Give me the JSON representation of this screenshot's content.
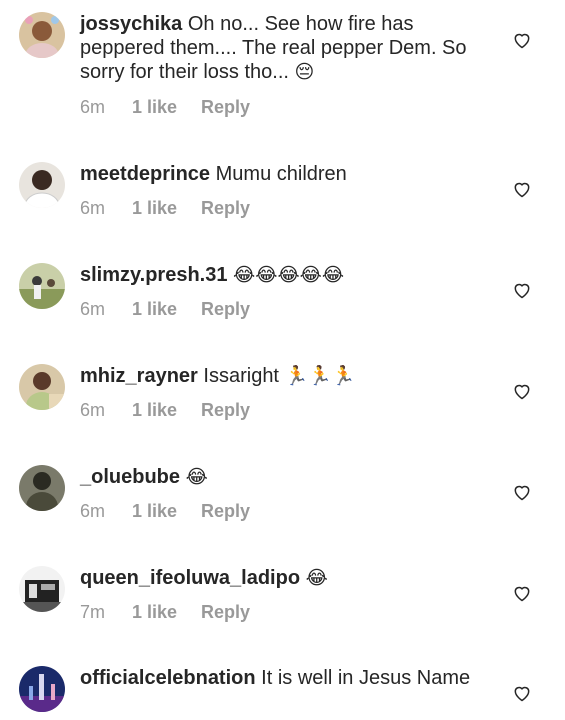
{
  "comments": [
    {
      "username": "jossychika",
      "text": "Oh no... See how fire has peppered them.... The real pepper Dem. So sorry for their loss tho...",
      "emoji": "😔",
      "time": "6m",
      "likes": "1 like",
      "reply": "Reply",
      "avatar_color": "#c8a878"
    },
    {
      "username": "meetdeprince",
      "text": "Mumu children",
      "emoji": "",
      "time": "6m",
      "likes": "1 like",
      "reply": "Reply",
      "avatar_color": "#6a5040"
    },
    {
      "username": "slimzy.presh.31",
      "text": "",
      "emoji": "😂😂😂😂😂",
      "time": "6m",
      "likes": "1 like",
      "reply": "Reply",
      "avatar_color": "#9aa86a"
    },
    {
      "username": "mhiz_rayner",
      "text": "Issaright",
      "emoji": "🏃🏃🏃",
      "time": "6m",
      "likes": "1 like",
      "reply": "Reply",
      "avatar_color": "#b88a5a"
    },
    {
      "username": "_oluebube",
      "text": "",
      "emoji": "😂",
      "time": "6m",
      "likes": "1 like",
      "reply": "Reply",
      "avatar_color": "#4a4a40"
    },
    {
      "username": "queen_ifeoluwa_ladipo",
      "text": "",
      "emoji": "😂",
      "time": "7m",
      "likes": "1 like",
      "reply": "Reply",
      "avatar_color": "#3a3a3a"
    },
    {
      "username": "officialcelebnation",
      "text": "It is well in Jesus Name",
      "emoji": "",
      "time": "",
      "likes": "",
      "reply": "",
      "avatar_color": "#2a3a8a"
    }
  ]
}
